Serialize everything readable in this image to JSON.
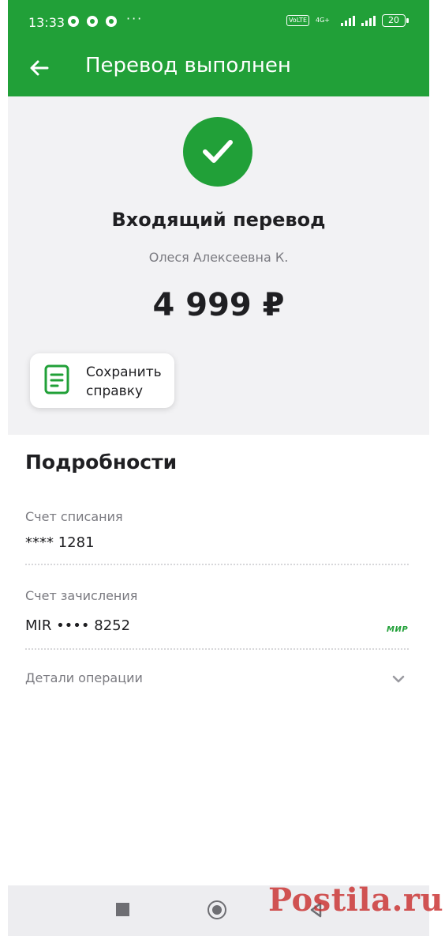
{
  "status_bar": {
    "time": "13:33",
    "more": "···",
    "volte": "VoLTE",
    "network": "4G+",
    "battery": "20"
  },
  "toolbar": {
    "title": "Перевод выполнен"
  },
  "summary": {
    "title": "Входящий перевод",
    "sender": "Олеся Алексеевна К.",
    "amount": "4 999 ₽",
    "save_label": "Сохранить справку"
  },
  "details": {
    "title": "Подробности",
    "debit_label": "Счет списания",
    "debit_value": "**** 1281",
    "credit_label": "Счет зачисления",
    "credit_value": "MIR •••• 8252",
    "card_brand": "МИР",
    "operation_label": "Детали операции"
  },
  "watermark": "Postila.ru",
  "colors": {
    "brand_green": "#21a038",
    "background_grey": "#f2f2f4",
    "muted_text": "#7a7a80"
  }
}
